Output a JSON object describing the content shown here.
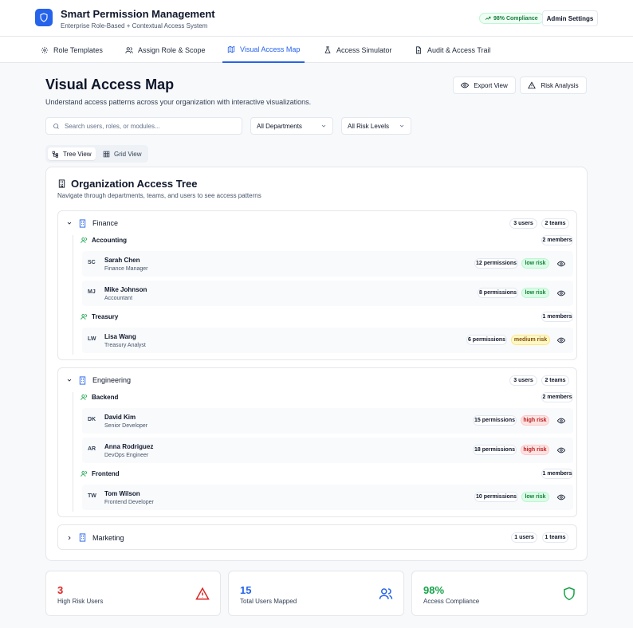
{
  "header": {
    "title": "Smart Permission Management",
    "subtitle": "Enterprise Role-Based + Contextual Access System",
    "compliance_badge": "98% Compliance",
    "admin_button": "Admin Settings"
  },
  "tabs": [
    {
      "label": "Role Templates",
      "icon": "gear-icon"
    },
    {
      "label": "Assign Role & Scope",
      "icon": "users-icon"
    },
    {
      "label": "Visual Access Map",
      "icon": "map-icon",
      "active": true
    },
    {
      "label": "Access Simulator",
      "icon": "flask-icon"
    },
    {
      "label": "Audit & Access Trail",
      "icon": "file-icon"
    }
  ],
  "page": {
    "title": "Visual Access Map",
    "description": "Understand access patterns across your organization with interactive visualizations.",
    "export_button": "Export View",
    "risk_button": "Risk Analysis"
  },
  "filters": {
    "search_placeholder": "Search users, roles, or modules...",
    "department": "All Departments",
    "risk": "All Risk Levels"
  },
  "view_toggle": {
    "tree": "Tree View",
    "grid": "Grid View",
    "active": "tree"
  },
  "tree": {
    "title": "Organization Access Tree",
    "description": "Navigate through departments, teams, and users to see access patterns",
    "departments": [
      {
        "name": "Finance",
        "users": "3 users",
        "teams": "2 teams",
        "expanded": true,
        "teams_list": [
          {
            "name": "Accounting",
            "members": "2 members",
            "users": [
              {
                "initials": "SC",
                "name": "Sarah Chen",
                "role": "Finance Manager",
                "permissions": "12 permissions",
                "risk": "low risk"
              },
              {
                "initials": "MJ",
                "name": "Mike Johnson",
                "role": "Accountant",
                "permissions": "8 permissions",
                "risk": "low risk"
              }
            ]
          },
          {
            "name": "Treasury",
            "members": "1 members",
            "users": [
              {
                "initials": "LW",
                "name": "Lisa Wang",
                "role": "Treasury Analyst",
                "permissions": "6 permissions",
                "risk": "medium risk"
              }
            ]
          }
        ]
      },
      {
        "name": "Engineering",
        "users": "3 users",
        "teams": "2 teams",
        "expanded": true,
        "teams_list": [
          {
            "name": "Backend",
            "members": "2 members",
            "users": [
              {
                "initials": "DK",
                "name": "David Kim",
                "role": "Senior Developer",
                "permissions": "15 permissions",
                "risk": "high risk"
              },
              {
                "initials": "AR",
                "name": "Anna Rodriguez",
                "role": "DevOps Engineer",
                "permissions": "18 permissions",
                "risk": "high risk"
              }
            ]
          },
          {
            "name": "Frontend",
            "members": "1 members",
            "users": [
              {
                "initials": "TW",
                "name": "Tom Wilson",
                "role": "Frontend Developer",
                "permissions": "10 permissions",
                "risk": "low risk"
              }
            ]
          }
        ]
      },
      {
        "name": "Marketing",
        "users": "1 users",
        "teams": "1 teams",
        "expanded": false
      }
    ]
  },
  "stats": [
    {
      "value": "3",
      "label": "High Risk Users",
      "color": "#dc2626",
      "icon": "alert-triangle-icon"
    },
    {
      "value": "15",
      "label": "Total Users Mapped",
      "color": "#2563eb",
      "icon": "users-icon"
    },
    {
      "value": "98%",
      "label": "Access Compliance",
      "color": "#16a34a",
      "icon": "shield-icon"
    }
  ],
  "colors": {
    "accent": "#2563eb",
    "danger": "#dc2626",
    "success": "#16a34a"
  }
}
